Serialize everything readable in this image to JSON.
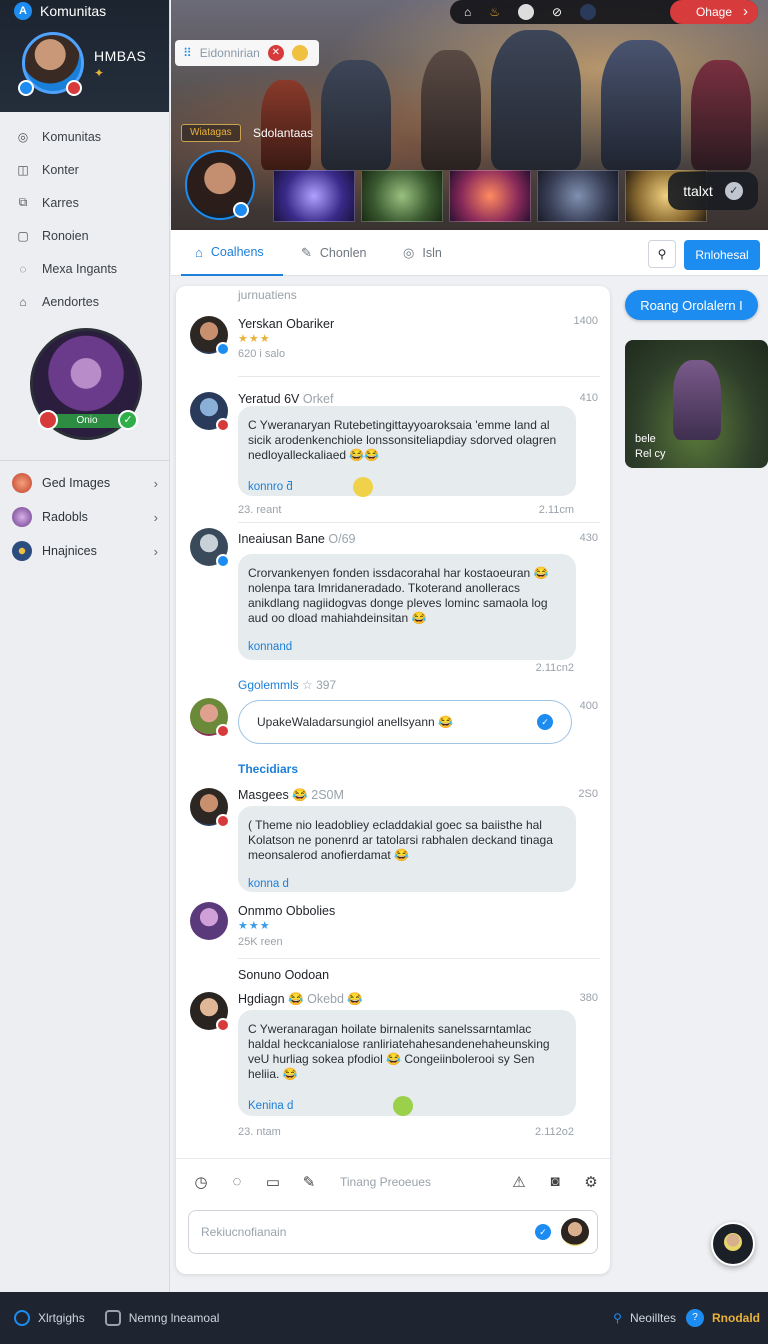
{
  "sidebar": {
    "app_title": "Komunitas",
    "profile_name": "HMBAS",
    "nav": [
      {
        "label": "Komunitas",
        "icon": "community-icon"
      },
      {
        "label": "Konter",
        "icon": "counter-icon"
      },
      {
        "label": "Karres",
        "icon": "cards-icon"
      },
      {
        "label": "Ronoien",
        "icon": "document-icon"
      },
      {
        "label": "Mexa Ingants",
        "icon": "chat-icon"
      },
      {
        "label": "Aendortes",
        "icon": "alert-icon"
      }
    ],
    "rank_label": "Onio",
    "groups": [
      {
        "label": "Ged Images",
        "color": "#e2604a"
      },
      {
        "label": "Radobls",
        "color": "#8a5fa8"
      },
      {
        "label": "Hnajnices",
        "color": "#2b4c7e"
      }
    ]
  },
  "banner": {
    "login_label": "Ohage",
    "search_placeholder": "Eidonnirian",
    "tag_label": "Wiatagas",
    "tag_text": "Sdolantaas",
    "pill_label": "ttalxt"
  },
  "tabs": {
    "items": [
      {
        "label": "Coalhens",
        "icon": "home-icon"
      },
      {
        "label": "Chonlen",
        "icon": "edit-icon"
      },
      {
        "label": "Isln",
        "icon": "circle-icon"
      }
    ],
    "primary_button": "Rnlohesal"
  },
  "feed": {
    "header": "jurnuatiens",
    "posts": [
      {
        "name": "Yerskan Obariker",
        "time": "1400",
        "stars": "★★★",
        "meta": "620 i salo"
      },
      {
        "name": "Yeratud 6V",
        "name_muted": "Orkef",
        "time": "410",
        "text": "C Yweranaryan Rutebetingittayyoaroksaia 'emme land al sicik arodenkenchiole lonssonsiteliapdiay sdorved olagren nedloyalleckaliaed 😂😂",
        "reply": "konnro ƌ",
        "foot": "23. reant",
        "foot_right": "2.11cm"
      },
      {
        "name": "Ineaiusan Bane",
        "name_muted": "O/69",
        "time": "430",
        "text": "Crorvankenyen fonden issdacorahal har kostaoeuran 😂 nolenpa tara lmridaneradado. Tkoterand anolleracs anikdlang nagiidogvas donge pleves lominc samaola log aud oo dload mahiahdeinsitan 😂",
        "reply": "konnand",
        "foot_right": "2.11cn2"
      },
      {
        "label": "Ggolemmls",
        "label_muted": "☆ 397",
        "time": "400",
        "input_text": "UpakeWaladarsungiol anellsyann 😂"
      },
      {
        "label": "Thecidiars"
      },
      {
        "name": "Masgees 😂",
        "name_muted": "2S0M",
        "time": "2S0",
        "text": "( Theme nio leadobliey ecladdakial goec sa baiisthe hal Kolatson ne ponenrd ar tatolarsi rabhalen deckand tinaga meonsalerod anofierdamat 😂",
        "reply": "konna d"
      },
      {
        "name": "Onmmo Obbolies",
        "stars": "★★★",
        "meta": "25K reen"
      },
      {
        "label_dark": "Sonuno Oodoan"
      },
      {
        "name": "Hgdiagn 😂",
        "name_muted": "Okebd 😂",
        "time": "380",
        "text": "C Yweranaragan hoilate birnalenits sanelssarntamlac haldal heckcanialose ranliriatehahesandenehaheunsking veU hurliag sokea pfodiol 😂 Congeiinbolerooi sy Sen heliia. 😂",
        "reply": "Kenina d",
        "foot": "23. ntam",
        "foot_right": "2.112o2"
      }
    ],
    "composer_placeholder": "Tinang Preoeues",
    "input_placeholder": "Rekiucnofianain"
  },
  "right": {
    "pill_label": "Roang Orolalern I",
    "card_caption_1": "bele",
    "card_caption_2": "Rel cy"
  },
  "bottom": {
    "left_1": "Xlrtgighs",
    "left_2": "Nemng lneamoal",
    "right_1": "Neoilltes",
    "brand": "Rnodald"
  }
}
